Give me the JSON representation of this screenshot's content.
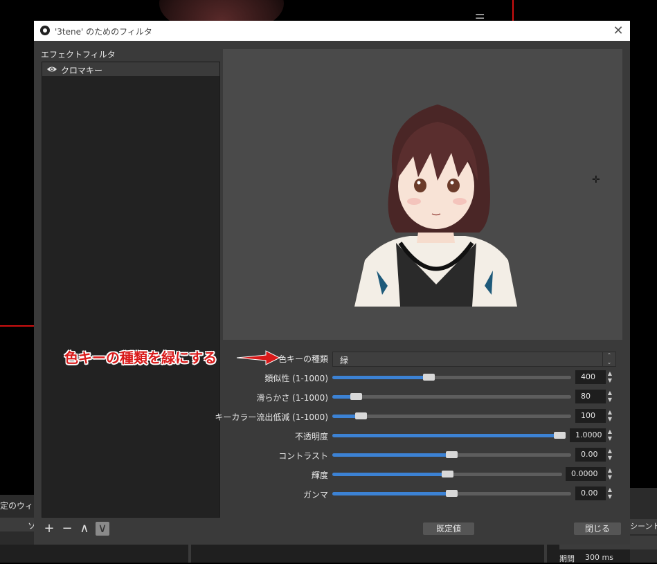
{
  "background": {
    "left_window_label": "定のウィンド",
    "left_strip_text": "ソ",
    "right_scene_label": "シーントラ",
    "period_label": "期間",
    "period_value": "300 ms"
  },
  "dialog": {
    "title": "'3tene' のためのフィルタ",
    "close_glyph": "✕",
    "effects_label": "エフェクトフィルタ",
    "filters": [
      {
        "label": "クロマキー",
        "visible": true
      }
    ],
    "toolbar": {
      "add": "+",
      "remove": "−",
      "up": "∧",
      "down": "∨"
    },
    "properties": {
      "color_type": {
        "label": "色キーの種類",
        "value": "緑"
      },
      "similarity": {
        "label": "類似性 (1-1000)",
        "value": "400",
        "fraction": 0.4
      },
      "smoothness": {
        "label": "滑らかさ (1-1000)",
        "value": "80",
        "fraction": 0.08
      },
      "spill": {
        "label": "キーカラー流出低減 (1-1000)",
        "value": "100",
        "fraction": 0.1
      },
      "opacity": {
        "label": "不透明度",
        "value": "1.0000",
        "fraction": 1.0
      },
      "contrast": {
        "label": "コントラスト",
        "value": "0.00",
        "fraction": 0.5
      },
      "brightness": {
        "label": "輝度",
        "value": "0.0000",
        "fraction": 0.5
      },
      "gamma": {
        "label": "ガンマ",
        "value": "0.00",
        "fraction": 0.5
      }
    },
    "defaults_button": "既定値",
    "close_button": "閉じる"
  },
  "annotation": {
    "text": "色キーの種類を緑にする",
    "color": "#d91a1a"
  },
  "colors": {
    "slider_fill": "#3c82d4",
    "dialog_bg": "#3a3a3a",
    "preview_bg": "#4a4a4a"
  }
}
